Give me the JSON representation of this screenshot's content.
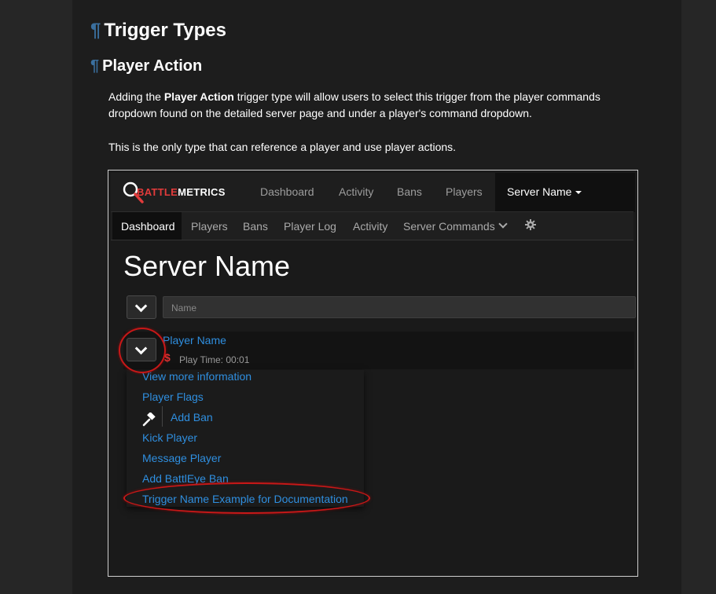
{
  "doc": {
    "heading1": "Trigger Types",
    "heading2": "Player Action",
    "pilcrow": "¶",
    "para1_pre": "Adding the ",
    "para1_bold": "Player Action",
    "para1_post": " trigger type will allow users to select this trigger from the player commands dropdown found on the detailed server page and under a player's command dropdown.",
    "para2": "This is the only type that can reference a player and use player actions."
  },
  "screenshot": {
    "logo": {
      "part1": "BATTLE",
      "part2": "METRICS"
    },
    "topnav": [
      "Dashboard",
      "Activity",
      "Bans",
      "Players"
    ],
    "topnav_active": "Server Name",
    "subnav_active": "Dashboard",
    "subnav": [
      "Players",
      "Bans",
      "Player Log",
      "Activity",
      "Server Commands"
    ],
    "server_title": "Server Name",
    "search_placeholder": "Name",
    "player": {
      "name": "Player Name",
      "currency": "$",
      "playtime": "Play Time: 00:01"
    },
    "menu": [
      "View more information",
      "Player Flags",
      "Add Ban",
      "Kick Player",
      "Message Player",
      "Add BattlEye Ban",
      "Trigger Name Example for Documentation"
    ]
  },
  "colors": {
    "link": "#2f8fe0",
    "highlight_ring": "#c81818",
    "logo_red": "#e23b3b"
  }
}
